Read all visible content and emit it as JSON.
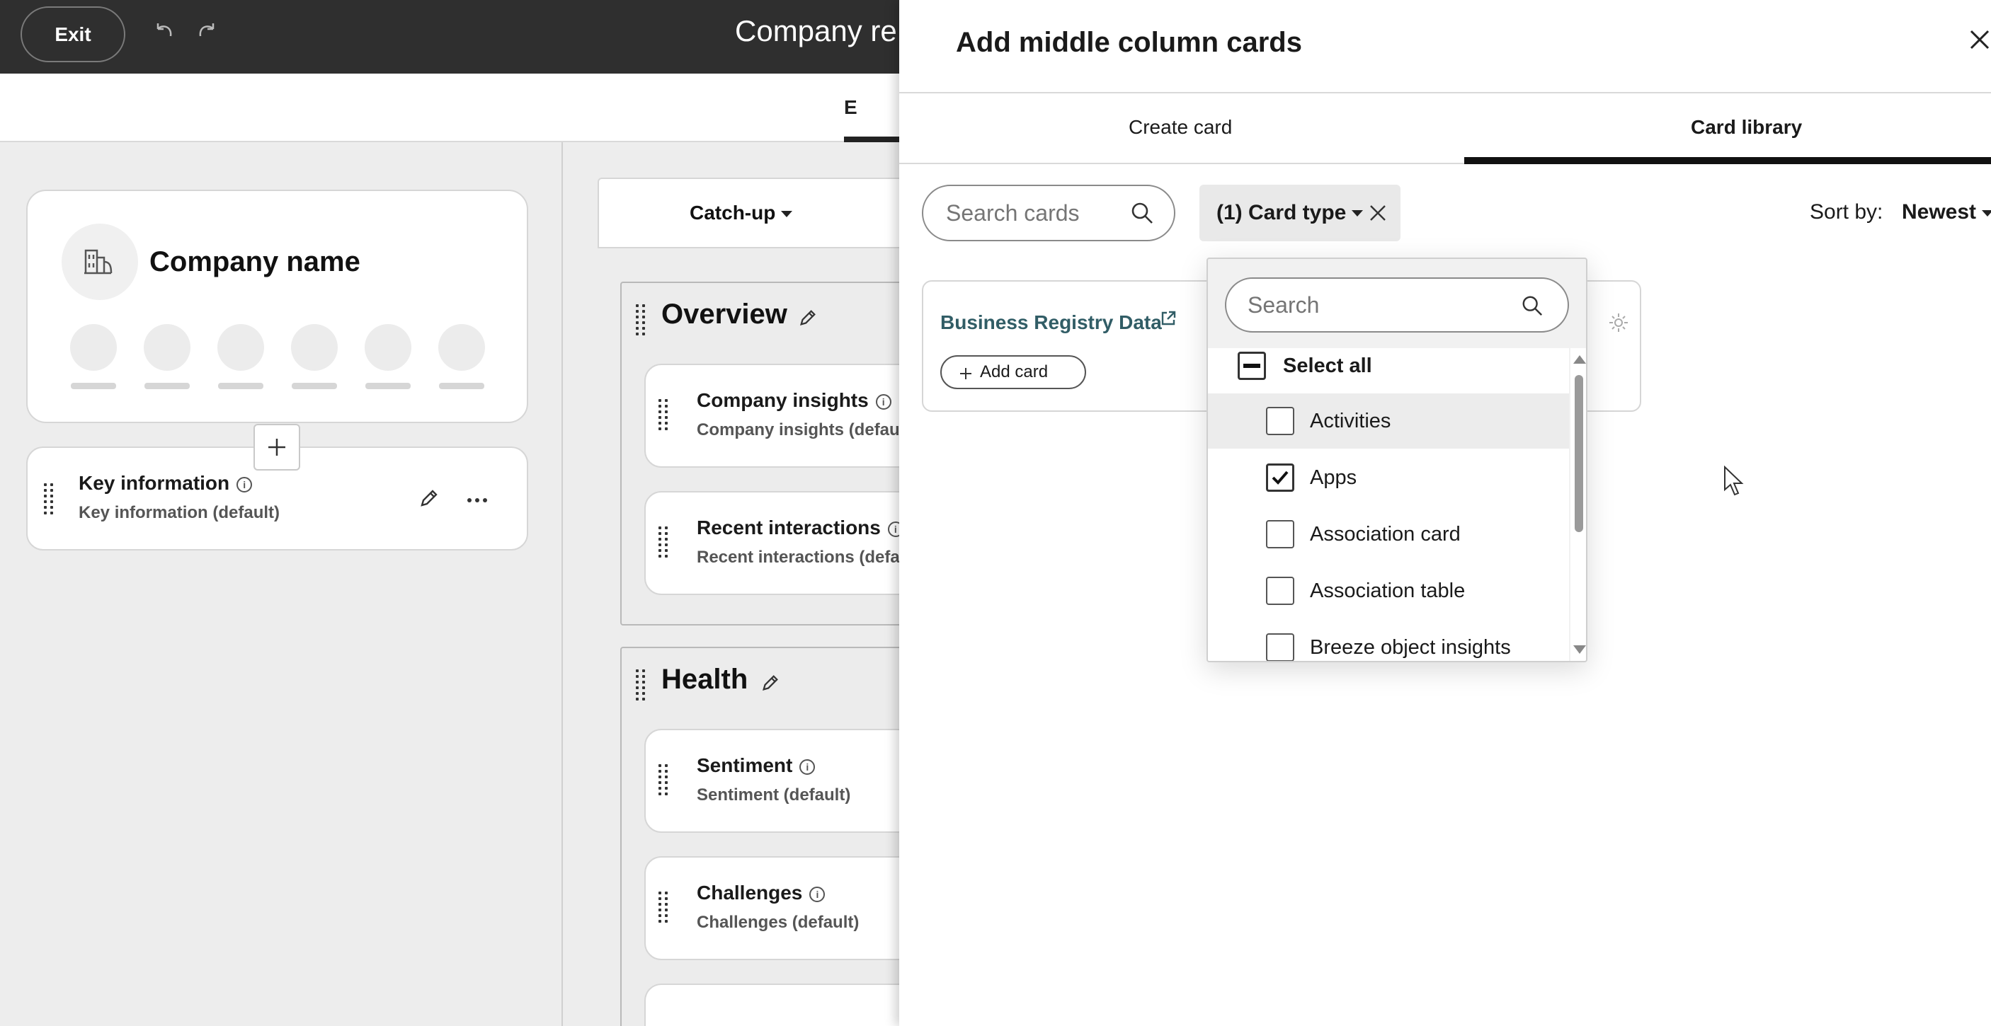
{
  "topbar": {
    "exit_label": "Exit",
    "page_title": "Company re"
  },
  "subheader": {
    "active_tab_partial": "E"
  },
  "left_column": {
    "company_card": {
      "name": "Company name"
    },
    "key_info": {
      "title": "Key information",
      "subtitle": "Key information (default)"
    }
  },
  "middle_column": {
    "view_selector": "Catch-up",
    "groups": [
      {
        "title": "Overview",
        "cards": [
          {
            "title": "Company insights",
            "subtitle": "Company insights (defau"
          },
          {
            "title": "Recent interactions",
            "subtitle": "Recent interactions (defa"
          }
        ]
      },
      {
        "title": "Health",
        "cards": [
          {
            "title": "Sentiment",
            "subtitle": "Sentiment (default)"
          },
          {
            "title": "Challenges",
            "subtitle": "Challenges (default)"
          }
        ]
      }
    ]
  },
  "panel": {
    "title": "Add middle column cards",
    "tabs": [
      {
        "label": "Create card",
        "active": false
      },
      {
        "label": "Card library",
        "active": true
      }
    ],
    "search": {
      "placeholder": "Search cards"
    },
    "filter_chip": "(1) Card type",
    "sort": {
      "label": "Sort by:",
      "value": "Newest"
    },
    "result_card": {
      "title": "Business Registry Data",
      "add_label": "Add card"
    }
  },
  "dropdown": {
    "search_placeholder": "Search",
    "select_all": "Select all",
    "options": [
      {
        "label": "Activities",
        "checked": false
      },
      {
        "label": "Apps",
        "checked": true
      },
      {
        "label": "Association card",
        "checked": false
      },
      {
        "label": "Association table",
        "checked": false
      },
      {
        "label": "Breeze object insights",
        "checked": false
      }
    ]
  },
  "colors": {
    "topbar": "#2f2f2f",
    "link_teal": "#315d66",
    "tab_underline": "#111111"
  }
}
